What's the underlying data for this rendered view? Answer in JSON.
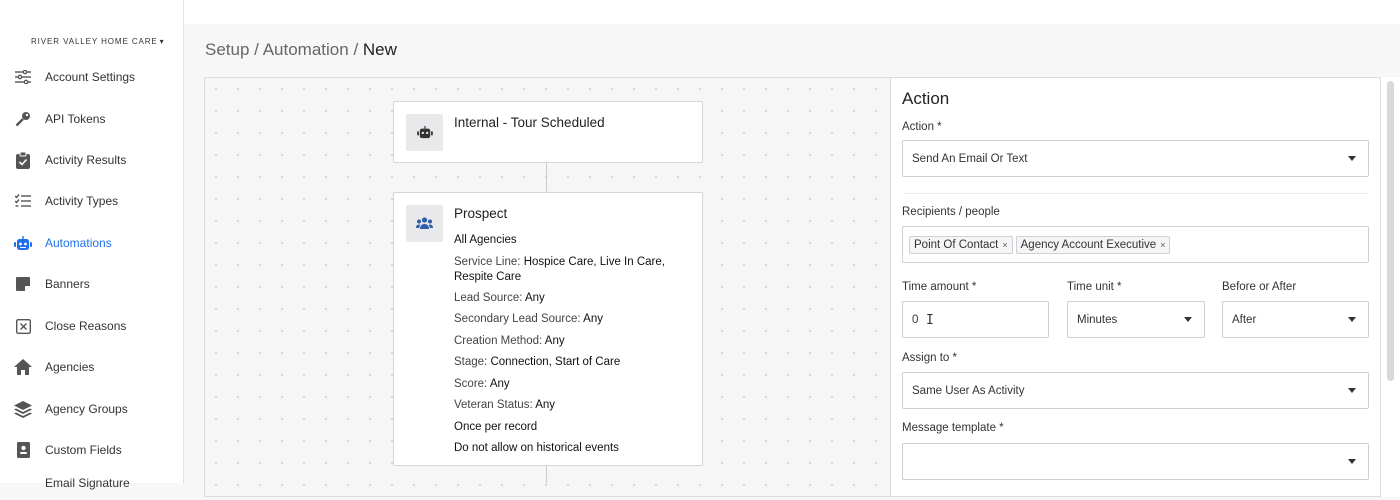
{
  "sidebar": {
    "org_name": "RIVER VALLEY HOME CARE",
    "items": [
      {
        "label": "Account Settings",
        "icon": "sliders-icon"
      },
      {
        "label": "API Tokens",
        "icon": "key-icon"
      },
      {
        "label": "Activity Results",
        "icon": "clipboard-check-icon"
      },
      {
        "label": "Activity Types",
        "icon": "list-check-icon"
      },
      {
        "label": "Automations",
        "icon": "robot-icon"
      },
      {
        "label": "Banners",
        "icon": "note-icon"
      },
      {
        "label": "Close Reasons",
        "icon": "x-square-icon"
      },
      {
        "label": "Agencies",
        "icon": "home-icon"
      },
      {
        "label": "Agency Groups",
        "icon": "layers-icon"
      },
      {
        "label": "Custom Fields",
        "icon": "id-card-icon"
      },
      {
        "label": "Email Signature",
        "icon": "pen-icon"
      }
    ],
    "active": "Automations"
  },
  "breadcrumb": {
    "part1": "Setup",
    "sep": "/",
    "part2": "Automation",
    "current": "New"
  },
  "workflow": {
    "trigger": {
      "title": "Internal - Tour Scheduled"
    },
    "filter": {
      "title": "Prospect",
      "agencies": "All Agencies",
      "service_line_label": "Service Line:",
      "service_line_value": "Hospice Care, Live In Care,",
      "service_line_value2": "Respite Care",
      "lead_source_label": "Lead Source:",
      "lead_source_value": "Any",
      "secondary_lead_source_label": "Secondary Lead Source:",
      "secondary_lead_source_value": "Any",
      "creation_method_label": "Creation Method:",
      "creation_method_value": "Any",
      "stage_label": "Stage:",
      "stage_value": "Connection, Start of Care",
      "score_label": "Score:",
      "score_value": "Any",
      "veteran_status_label": "Veteran Status:",
      "veteran_status_value": "Any",
      "once_per_record": "Once per record",
      "historical": "Do not allow on historical events"
    }
  },
  "action_panel": {
    "title": "Action",
    "action_label": "Action *",
    "action_value": "Send An Email Or Text",
    "recipients_label": "Recipients / people",
    "recipients": [
      "Point Of Contact",
      "Agency Account Executive"
    ],
    "remove_glyph": "×",
    "time_amount_label": "Time amount *",
    "time_amount_value": "0",
    "time_unit_label": "Time unit *",
    "time_unit_value": "Minutes",
    "before_after_label": "Before or After",
    "before_after_value": "After",
    "assign_to_label": "Assign to *",
    "assign_to_value": "Same User As Activity",
    "message_template_label": "Message template *",
    "message_template_value": ""
  },
  "colors": {
    "accent": "#1f6feb"
  }
}
